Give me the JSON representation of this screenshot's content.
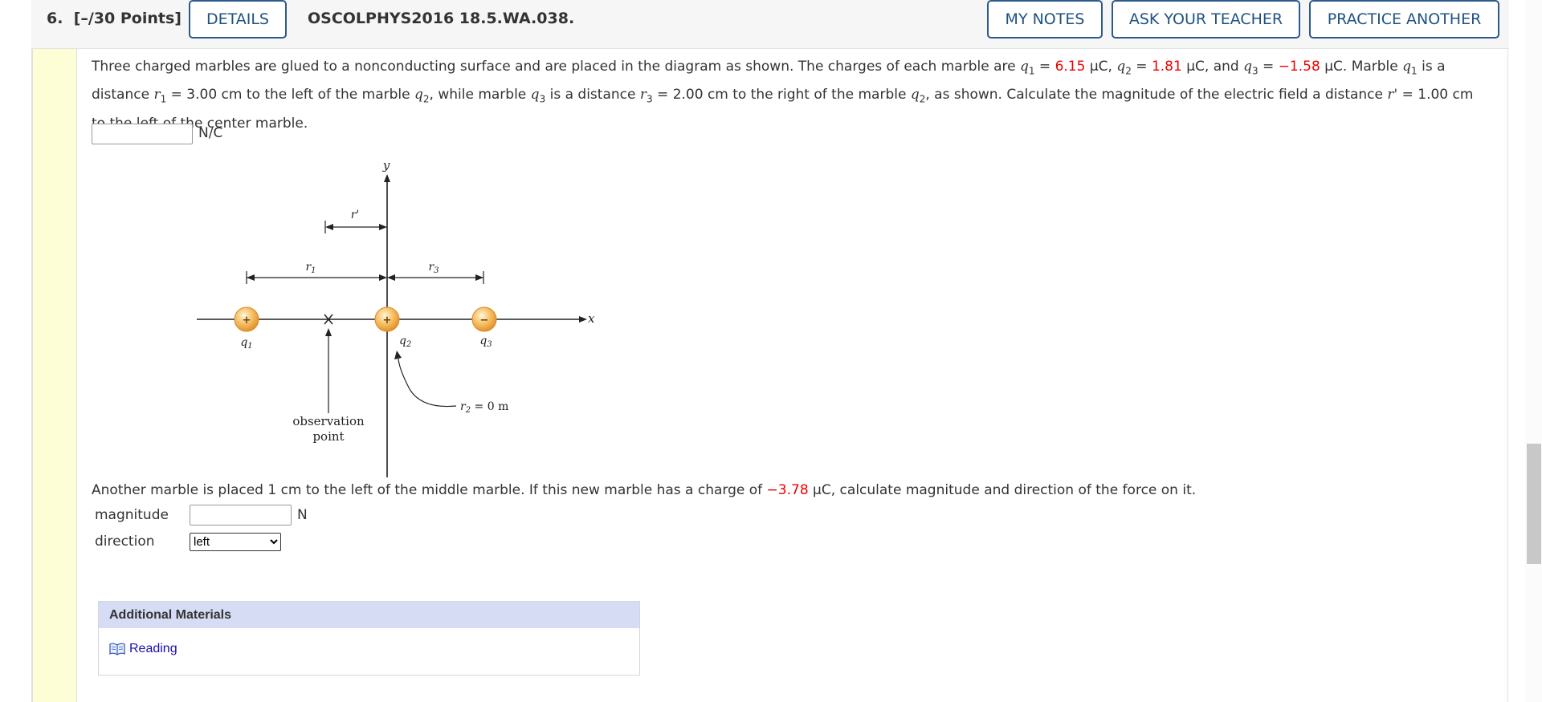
{
  "header": {
    "question_number": "6.",
    "points": "[–/30 Points]",
    "details_label": "DETAILS",
    "problem_code": "OSCOLPHYS2016 18.5.WA.038.",
    "my_notes_label": "MY NOTES",
    "ask_teacher_label": "ASK YOUR TEACHER",
    "practice_another_label": "PRACTICE ANOTHER"
  },
  "problem": {
    "s1": "Three charged marbles are glued to a nonconducting surface and are placed in the diagram as shown. The charges of each marble are ",
    "q1_sym": "q",
    "q1_sub": "1",
    "eq": " = ",
    "q1_val": "6.15",
    "q1_unit": " μC, ",
    "q2_sym": "q",
    "q2_sub": "2",
    "q2_val": "1.81",
    "q2_unit": " μC, and ",
    "q3_sym": "q",
    "q3_sub": "3",
    "q3_val": "−1.58",
    "q3_unit": " μC. Marble ",
    "s2": " is a distance ",
    "r1_sym": "r",
    "r1_sub": "1",
    "s3": " = 3.00 cm to the left of the marble ",
    "s4": ", while marble ",
    "s5": " is a distance ",
    "r3_sym": "r",
    "r3_sub": "3",
    "s6": " = 2.00 cm to the right of the marble ",
    "s7": ", as shown. Calculate the magnitude of the electric field a distance ",
    "rp_sym": "r'",
    "s8": " = 1.00 cm to the left of the center marble.",
    "field_unit": "N/C",
    "field_value": ""
  },
  "part2": {
    "s1": "Another marble is placed 1 cm to the left of the middle marble. If this new marble has a charge of ",
    "charge_val": "−3.78",
    "s2": " μC, calculate magnitude and direction of the force on it.",
    "magnitude_label": "magnitude",
    "magnitude_value": "",
    "magnitude_unit": "N",
    "direction_label": "direction",
    "direction_selected": "left"
  },
  "diagram": {
    "y_label": "y",
    "x_label": "x",
    "rprime_label": "r'",
    "r1_label": "r",
    "r1_sub": "1",
    "r3_label": "r",
    "r3_sub": "3",
    "plus": "+",
    "minus": "−",
    "q1_label": "q",
    "q1_sub": "1",
    "q2_label": "q",
    "q2_sub": "2",
    "q3_label": "q",
    "q3_sub": "3",
    "r2_label": "r",
    "r2_sub": "2",
    "r2_value": " = 0 m",
    "obs_line1": "observation",
    "obs_line2": "point",
    "marble_color": "#f0a030"
  },
  "materials": {
    "title": "Additional Materials",
    "link_label": "Reading",
    "link_icon": "book-icon"
  },
  "colors": {
    "accent": "#1f5280",
    "value_red": "#e00000",
    "left_strip": "#fdfdd6",
    "materials_header": "#d5dcf4"
  }
}
